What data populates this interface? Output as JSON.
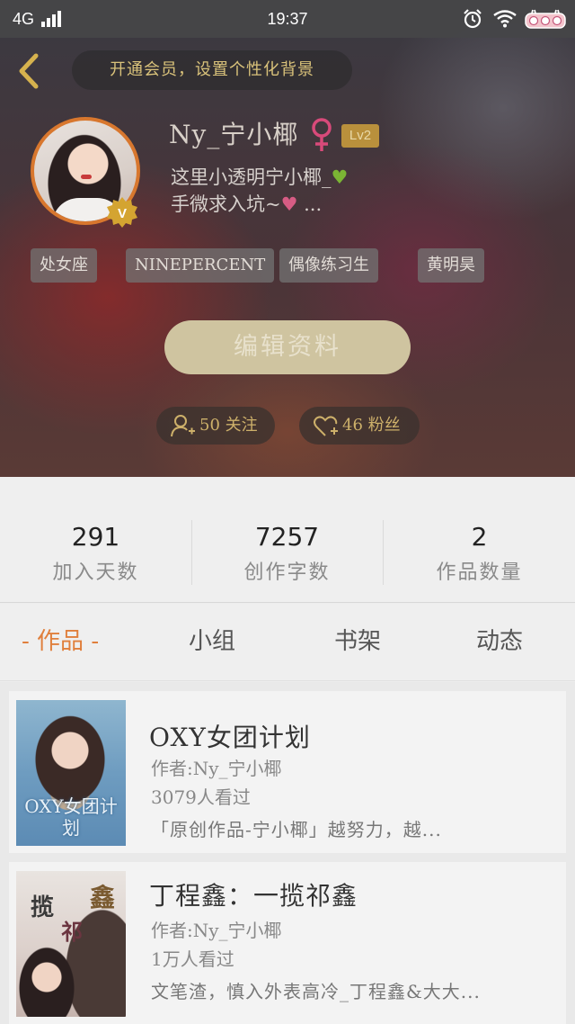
{
  "status_bar": {
    "network": "4G",
    "time": "19:37"
  },
  "header": {
    "vip_banner": "开通会员，设置个性化背景",
    "username": "Ny_宁小椰",
    "level": "Lv2",
    "bio_line1": "这里小透明宁小椰_",
    "bio_line1_emoji": "♥",
    "bio_line2": "手微求入坑~",
    "bio_line2_emoji": "♥",
    "bio_line2_suffix": "...",
    "tags": [
      "处女座",
      "NINEPERCENT",
      "偶像练习生",
      "黄明昊"
    ],
    "edit_button": "编辑资料",
    "follow_label": "50 关注",
    "fans_label": "46 粉丝"
  },
  "stats": [
    {
      "value": "291",
      "label": "加入天数"
    },
    {
      "value": "7257",
      "label": "创作字数"
    },
    {
      "value": "2",
      "label": "作品数量"
    }
  ],
  "tabs": [
    {
      "label": "- 作品 -",
      "active": true
    },
    {
      "label": "小组",
      "active": false
    },
    {
      "label": "书架",
      "active": false
    },
    {
      "label": "动态",
      "active": false
    }
  ],
  "works": [
    {
      "title": "OXY女团计划",
      "author": "作者:Ny_宁小椰",
      "views": "3079人看过",
      "desc": "「原创作品-宁小椰」越努力，越...",
      "cover_text": "OXY女团计划"
    },
    {
      "title": "丁程鑫：一揽祁鑫",
      "author": "作者:Ny_宁小椰",
      "views": "1万人看过",
      "desc": "文笔渣，慎入外表高冷_丁程鑫&大大...",
      "cover_chars": [
        "揽",
        "祁",
        "鑫"
      ]
    }
  ],
  "colors": {
    "accent_orange": "#e07f3c",
    "gold": "#cdb06a",
    "avatar_ring": "#d8772e"
  }
}
